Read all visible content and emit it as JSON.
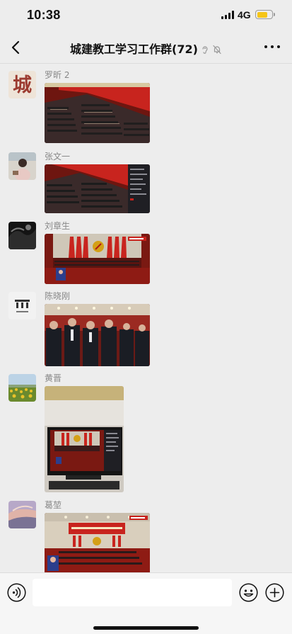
{
  "status_bar": {
    "time": "10:38",
    "network": "4G",
    "icons": [
      "signal-icon",
      "battery-icon"
    ],
    "battery_fill_fraction": 0.72,
    "battery_color": "#f5c518"
  },
  "nav": {
    "title": "城建教工学习工作群(72)",
    "icons": [
      "back-chevron-icon",
      "ear-icon",
      "mute-bell-icon",
      "more-icon"
    ]
  },
  "messages": [
    {
      "sender": "罗昕 2",
      "avatar": "avatar-calligraphy",
      "avatar_text": "城",
      "image": "congress-hall-photo"
    },
    {
      "sender": "张文一",
      "avatar": "avatar-person",
      "image": "congress-hall-screen-photo"
    },
    {
      "sender": "刘章生",
      "avatar": "avatar-dark-landscape",
      "image": "congress-stage-tv-photo"
    },
    {
      "sender": "陈晓刚",
      "avatar": "avatar-logo",
      "image": "attendees-standing-photo"
    },
    {
      "sender": "黄晋",
      "avatar": "avatar-sunflower-field",
      "image": "monitor-broadcast-photo"
    },
    {
      "sender": "葛堃",
      "avatar": "avatar-sky",
      "image": "congress-stage-banner-photo"
    }
  ],
  "input_bar": {
    "icons": [
      "voice-icon",
      "emoji-icon",
      "plus-icon"
    ],
    "placeholder": ""
  },
  "colors": {
    "background": "#ededed",
    "banner_red": "#c8241e",
    "hall_red": "#8e1b14"
  }
}
